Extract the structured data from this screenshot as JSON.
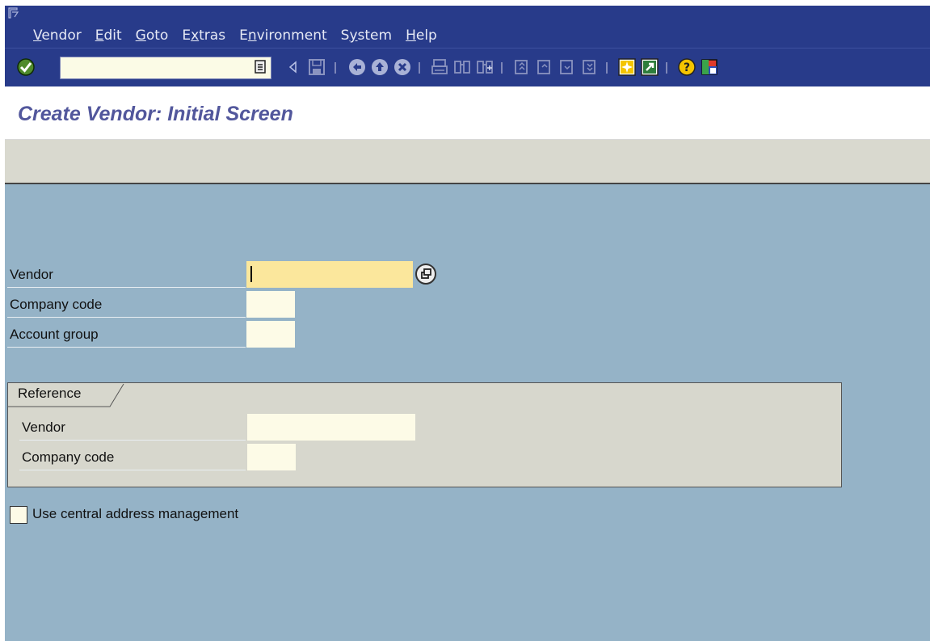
{
  "menu": {
    "items": [
      {
        "pre": "",
        "u": "V",
        "post": "endor"
      },
      {
        "pre": "",
        "u": "E",
        "post": "dit"
      },
      {
        "pre": "",
        "u": "G",
        "post": "oto"
      },
      {
        "pre": "E",
        "u": "x",
        "post": "tras"
      },
      {
        "pre": "E",
        "u": "n",
        "post": "vironment"
      },
      {
        "pre": "S",
        "u": "y",
        "post": "stem"
      },
      {
        "pre": "",
        "u": "H",
        "post": "elp"
      }
    ]
  },
  "toolbar": {
    "command_field_value": "",
    "icons": [
      "enter-icon",
      "back-arrow-icon",
      "save-icon",
      "back-icon",
      "exit-icon",
      "cancel-icon",
      "print-icon",
      "find-icon",
      "find-next-icon",
      "first-page-icon",
      "previous-page-icon",
      "next-page-icon",
      "last-page-icon",
      "create-session-icon",
      "shortcut-icon",
      "help-icon",
      "layout-menu-icon"
    ]
  },
  "page": {
    "title": "Create Vendor: Initial Screen"
  },
  "form": {
    "vendor_label": "Vendor",
    "vendor_value": "",
    "company_code_label": "Company code",
    "company_code_value": "",
    "account_group_label": "Account group",
    "account_group_value": ""
  },
  "reference": {
    "tab_label": "Reference",
    "vendor_label": "Vendor",
    "vendor_value": "",
    "company_code_label": "Company code",
    "company_code_value": ""
  },
  "options": {
    "central_address_label": "Use central address management",
    "central_address_checked": false
  },
  "colors": {
    "menubar_bg": "#283b8a",
    "title_text": "#52579c",
    "content_bg": "#95b3c7",
    "active_field": "#fbe79c",
    "frame_bg": "#d7d7cd"
  }
}
